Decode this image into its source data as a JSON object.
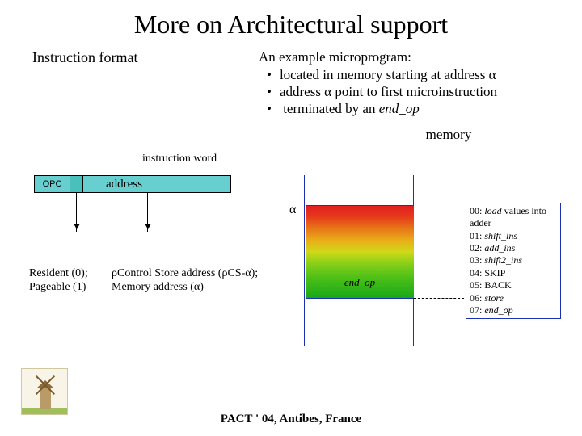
{
  "title": "More on Architectural support",
  "left_heading": "Instruction format",
  "right": {
    "heading": "An example microprogram:",
    "b1": "located in memory starting at address α",
    "b2": "address α point to first microinstruction",
    "b3_pre": "terminated by an ",
    "b3_em": "end_op"
  },
  "memory_label": "memory",
  "instr": {
    "word_label": "instruction word",
    "opc": "OPC",
    "address": "address"
  },
  "resident": {
    "l1": "Resident (0);",
    "l2": "Pageable (1)"
  },
  "control": {
    "l1": "ρControl Store address (ρCS-α);",
    "l2": "Memory address (α)"
  },
  "alpha": "α",
  "endop": "end_op",
  "program": {
    "p0_pre": "00: ",
    "p0_em": "load",
    "p0_post": " values into adder",
    "p1_pre": "01: ",
    "p1_em": "shift_ins",
    "p2_pre": "02: ",
    "p2_em": "add_ins",
    "p3_pre": "03: ",
    "p3_em": "shift2_ins",
    "p4": "04: SKIP",
    "p5": "05: BACK",
    "p6_pre": "06: ",
    "p6_em": "store",
    "p7_pre": "07: ",
    "p7_em": "end_op"
  },
  "footer": "PACT ' 04, Antibes, France"
}
